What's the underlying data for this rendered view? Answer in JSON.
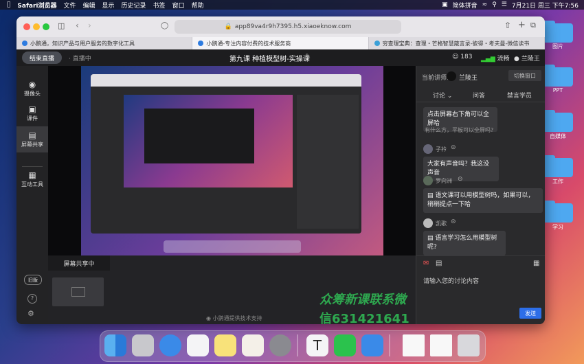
{
  "menubar": {
    "app": "Safari浏览器",
    "items": [
      "文件",
      "编辑",
      "显示",
      "历史记录",
      "书签",
      "窗口",
      "帮助"
    ],
    "input_method": "简体拼音",
    "datetime": "7月21日 周三 下午7:56"
  },
  "desktop": {
    "folders": [
      "图片",
      "PPT",
      "自媒体",
      "工作",
      "学习"
    ]
  },
  "browser": {
    "url": "app89va4r9h7395.h5.xiaoeknow.com",
    "tabs": [
      "小鹅通，知识产品与用户服务的数字化工具",
      "小鹅通-专注内容付费的技术服务商",
      "穷查理宝典：查理・芒格智慧箴言录-彼得・考夫曼-微信读书"
    ]
  },
  "live": {
    "end_button": "结束直播",
    "status": "直播中",
    "title": "第九课 种植模型树-实操课",
    "viewers": "183",
    "network": "流畅",
    "host_name": "兰陵王"
  },
  "sidebar": {
    "items": [
      "摄像头",
      "课件",
      "屏幕共享",
      "互动工具"
    ],
    "old_version": "旧版"
  },
  "bottom": {
    "screen_share_label": "屏幕共享中",
    "powered_by": "小鹅通提供技术支持"
  },
  "panel": {
    "current_speaker_label": "当前讲师:",
    "speaker_name": "兰陵王",
    "switch_button": "切换窗口",
    "tabs": [
      "讨论",
      "问答",
      "禁言学员"
    ],
    "messages": [
      {
        "name": "",
        "text": "点击屏幕右下角可以全屏哈",
        "sub": "有什么方，平板可以全屏吗?"
      },
      {
        "name": "子衿",
        "text": "大家有声音吗？我这没声音"
      },
      {
        "name": "罗向洲",
        "text": "语文课可以用模型树吗，如果可以，稍稍提点一下哈"
      },
      {
        "name": "凯歌",
        "text": "语言学习怎么用模型树呢?"
      }
    ],
    "input_placeholder": "请输入您的讨论内容",
    "send_button": "发送"
  },
  "watermark": {
    "line1": "众筹新课联系微",
    "line2": "信631421641"
  },
  "dock": {
    "icons": [
      "finder-icon",
      "launchpad-icon",
      "safari-icon",
      "reminders-icon",
      "notes-icon",
      "pages-icon",
      "system-preferences-icon",
      "typora-icon",
      "wechat-icon",
      "feishu-icon",
      "document-icon",
      "document-icon",
      "trash-icon"
    ]
  }
}
